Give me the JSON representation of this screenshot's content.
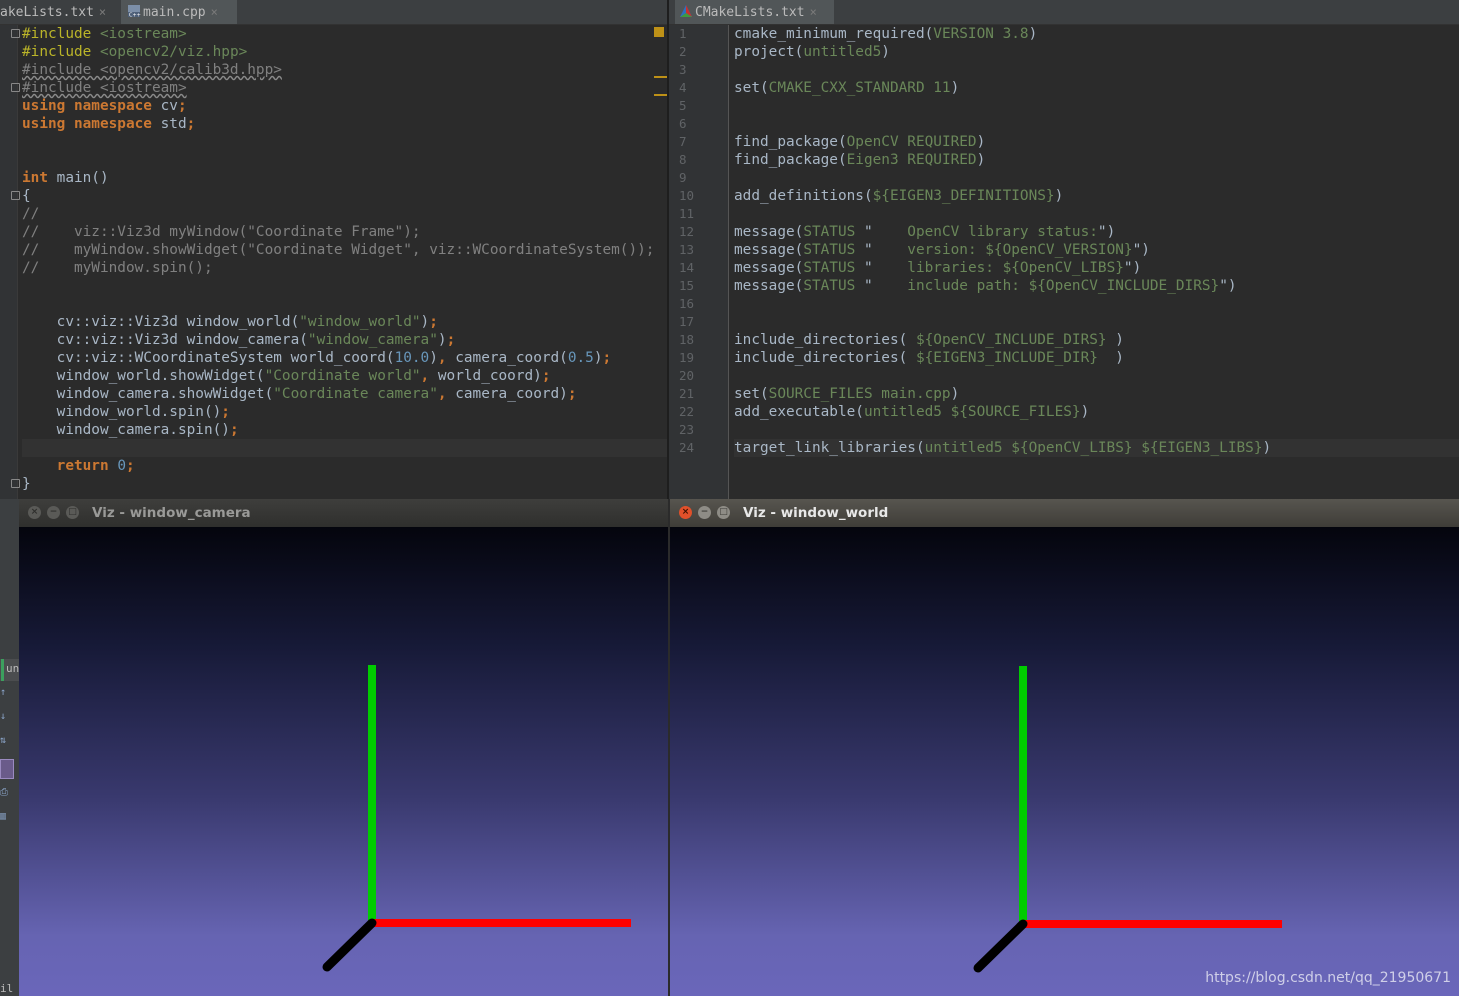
{
  "left_editor": {
    "tabs": [
      {
        "label": "akeLists.txt",
        "close": "×"
      },
      {
        "label": "main.cpp",
        "close": "×"
      }
    ],
    "lines": [
      [
        [
          "pp",
          "#include "
        ],
        [
          "str",
          "<iostream>"
        ]
      ],
      [
        [
          "pp",
          "#include "
        ],
        [
          "str",
          "<opencv2/viz.hpp>"
        ]
      ],
      [
        [
          "wavy",
          "#include <opencv2/calib3d.hpp>"
        ]
      ],
      [
        [
          "wavy",
          "#include <iostream>"
        ]
      ],
      [
        [
          "kw",
          "using namespace "
        ],
        [
          "",
          "cv"
        ],
        [
          "kw",
          ";"
        ]
      ],
      [
        [
          "kw",
          "using namespace "
        ],
        [
          "",
          "std"
        ],
        [
          "kw",
          ";"
        ]
      ],
      [],
      [],
      [
        [
          "kw",
          "int "
        ],
        [
          "",
          "main()"
        ]
      ],
      [
        [
          "",
          "{"
        ]
      ],
      [
        [
          "cmt",
          "//"
        ]
      ],
      [
        [
          "cmt",
          "//    viz::Viz3d myWindow(\"Coordinate Frame\");"
        ]
      ],
      [
        [
          "cmt",
          "//    myWindow.showWidget(\"Coordinate Widget\", viz::WCoordinateSystem());"
        ]
      ],
      [
        [
          "cmt",
          "//    myWindow.spin();"
        ]
      ],
      [],
      [],
      [
        [
          "",
          "    cv::viz::Viz3d window_world("
        ],
        [
          "str",
          "\"window_world\""
        ],
        [
          "",
          ")"
        ],
        [
          "kw",
          ";"
        ]
      ],
      [
        [
          "",
          "    cv::viz::Viz3d window_camera("
        ],
        [
          "str",
          "\"window_camera\""
        ],
        [
          "",
          ")"
        ],
        [
          "kw",
          ";"
        ]
      ],
      [
        [
          "",
          "    cv::viz::WCoordinateSystem world_coord("
        ],
        [
          "num",
          "10.0"
        ],
        [
          "",
          ")"
        ],
        [
          "kw",
          ", "
        ],
        [
          "",
          "camera_coord("
        ],
        [
          "num",
          "0.5"
        ],
        [
          "",
          ")"
        ],
        [
          "kw",
          ";"
        ]
      ],
      [
        [
          "",
          "    window_world.showWidget("
        ],
        [
          "str",
          "\"Coordinate world\""
        ],
        [
          "kw",
          ", "
        ],
        [
          "",
          "world_coord)"
        ],
        [
          "kw",
          ";"
        ]
      ],
      [
        [
          "",
          "    window_camera.showWidget("
        ],
        [
          "str",
          "\"Coordinate camera\""
        ],
        [
          "kw",
          ", "
        ],
        [
          "",
          "camera_coord)"
        ],
        [
          "kw",
          ";"
        ]
      ],
      [
        [
          "",
          "    window_world.spin()"
        ],
        [
          "kw",
          ";"
        ]
      ],
      [
        [
          "",
          "    window_camera.spin()"
        ],
        [
          "kw",
          ";"
        ]
      ],
      [],
      [
        [
          "kw",
          "    return "
        ],
        [
          "num",
          "0"
        ],
        [
          "kw",
          ";"
        ]
      ],
      [
        [
          "",
          "}"
        ]
      ]
    ]
  },
  "right_editor": {
    "tabs": [
      {
        "label": "CMakeLists.txt",
        "close": "×"
      }
    ],
    "line_numbers": [
      "1",
      "2",
      "3",
      "4",
      "5",
      "6",
      "7",
      "8",
      "9",
      "10",
      "11",
      "12",
      "13",
      "14",
      "15",
      "16",
      "17",
      "18",
      "19",
      "20",
      "21",
      "22",
      "23",
      "24"
    ],
    "lines": [
      [
        [
          "",
          "cmake_minimum_required("
        ],
        [
          "str",
          "VERSION 3.8"
        ],
        [
          "",
          ")"
        ]
      ],
      [
        [
          "",
          "project("
        ],
        [
          "str",
          "untitled5"
        ],
        [
          "",
          ")"
        ]
      ],
      [],
      [
        [
          "",
          "set("
        ],
        [
          "str",
          "CMAKE_CXX_STANDARD 11"
        ],
        [
          "",
          ")"
        ]
      ],
      [],
      [],
      [
        [
          "",
          "find_package("
        ],
        [
          "str",
          "OpenCV REQUIRED"
        ],
        [
          "",
          ")"
        ]
      ],
      [
        [
          "",
          "find_package("
        ],
        [
          "str",
          "Eigen3 REQUIRED"
        ],
        [
          "",
          ")"
        ]
      ],
      [],
      [
        [
          "",
          "add_definitions("
        ],
        [
          "str",
          "${EIGEN3_DEFINITIONS}"
        ],
        [
          "",
          ")"
        ]
      ],
      [],
      [
        [
          "",
          "message("
        ],
        [
          "str",
          "STATUS "
        ],
        [
          "",
          "\"    "
        ],
        [
          "str",
          "OpenCV library status:"
        ],
        [
          "",
          "\")"
        ]
      ],
      [
        [
          "",
          "message("
        ],
        [
          "str",
          "STATUS "
        ],
        [
          "",
          "\"    "
        ],
        [
          "str",
          "version: ${OpenCV_VERSION}"
        ],
        [
          "",
          "\")"
        ]
      ],
      [
        [
          "",
          "message("
        ],
        [
          "str",
          "STATUS "
        ],
        [
          "",
          "\"    "
        ],
        [
          "str",
          "libraries: ${OpenCV_LIBS}"
        ],
        [
          "",
          "\")"
        ]
      ],
      [
        [
          "",
          "message("
        ],
        [
          "str",
          "STATUS "
        ],
        [
          "",
          "\"    "
        ],
        [
          "str",
          "include path: ${OpenCV_INCLUDE_DIRS}"
        ],
        [
          "",
          "\")"
        ]
      ],
      [],
      [],
      [
        [
          "",
          "include_directories( "
        ],
        [
          "str",
          "${OpenCV_INCLUDE_DIRS}"
        ],
        [
          "",
          " )"
        ]
      ],
      [
        [
          "",
          "include_directories( "
        ],
        [
          "str",
          "${EIGEN3_INCLUDE_DIR}"
        ],
        [
          "",
          "  )"
        ]
      ],
      [],
      [
        [
          "",
          "set("
        ],
        [
          "str",
          "SOURCE_FILES main.cpp"
        ],
        [
          "",
          ")"
        ]
      ],
      [
        [
          "",
          "add_executable("
        ],
        [
          "str",
          "untitled5 ${SOURCE_FILES}"
        ],
        [
          "",
          ")"
        ]
      ],
      [],
      [
        [
          "",
          "target_link_libraries("
        ],
        [
          "str",
          "untitled5 ${OpenCV_LIBS} ${EIGEN3_LIBS}"
        ],
        [
          "",
          ")"
        ]
      ]
    ]
  },
  "viz_camera": {
    "title": "Viz - window_camera",
    "buttons": [
      "×",
      "−",
      "□"
    ]
  },
  "viz_world": {
    "title": "Viz - window_world",
    "buttons": [
      "×",
      "−",
      "□"
    ]
  },
  "side_panel": {
    "label": "un",
    "bottom_label": "il"
  },
  "colors": {
    "x_axis": "#ff0000",
    "y_axis": "#00cc00",
    "z_axis": "#000000"
  },
  "watermark": "https://blog.csdn.net/qq_21950671"
}
